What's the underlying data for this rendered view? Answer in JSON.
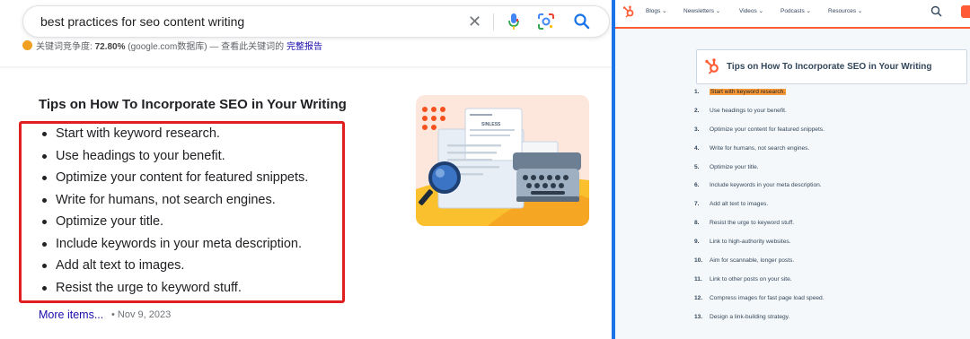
{
  "search": {
    "query": "best practices for seo content writing"
  },
  "keyword_bar": {
    "prefix": "关键词竞争度:",
    "percent": "72.80%",
    "source": "(google.com数据库) — 查看此关键词的",
    "report_link": "完整报告"
  },
  "snippet": {
    "title": "Tips on How To Incorporate SEO in Your Writing",
    "items": [
      "Start with keyword research.",
      "Use headings to your benefit.",
      "Optimize your content for featured snippets.",
      "Write for humans, not search engines.",
      "Optimize your title.",
      "Include keywords in your meta description.",
      "Add alt text to images.",
      "Resist the urge to keyword stuff."
    ],
    "more_link": "More items...",
    "date": "• Nov 9, 2023"
  },
  "illustration": {
    "card_text": "SINLESS"
  },
  "right_panel": {
    "nav": [
      "Blogs ⌄",
      "Newsletters ⌄",
      "Videos ⌄",
      "Podcasts ⌄",
      "Resources ⌄"
    ],
    "toc_title": "Tips on How To Incorporate SEO in Your Writing",
    "list": [
      {
        "num": "1.",
        "text": "Start with keyword research."
      },
      {
        "num": "2.",
        "text": "Use headings to your benefit."
      },
      {
        "num": "3.",
        "text": "Optimize your content for featured snippets."
      },
      {
        "num": "4.",
        "text": "Write for humans, not search engines."
      },
      {
        "num": "5.",
        "text": "Optimize your title."
      },
      {
        "num": "6.",
        "text": "Include keywords in your meta description."
      },
      {
        "num": "7.",
        "text": "Add alt text to images."
      },
      {
        "num": "8.",
        "text": "Resist the urge to keyword stuff."
      },
      {
        "num": "9.",
        "text": "Link to high-authority websites."
      },
      {
        "num": "10.",
        "text": "Aim for scannable, longer posts."
      },
      {
        "num": "11.",
        "text": "Link to other posts on your site."
      },
      {
        "num": "12.",
        "text": "Compress images for fast page load speed."
      },
      {
        "num": "13.",
        "text": "Design a link-building strategy."
      }
    ],
    "highlighted_index": 0
  },
  "colors": {
    "google_blue": "#1a73e8",
    "link": "#1a0dab",
    "highlight_box": "#e02020",
    "hubspot_orange": "#ff5c35",
    "text_highlight": "#f89a3a"
  }
}
